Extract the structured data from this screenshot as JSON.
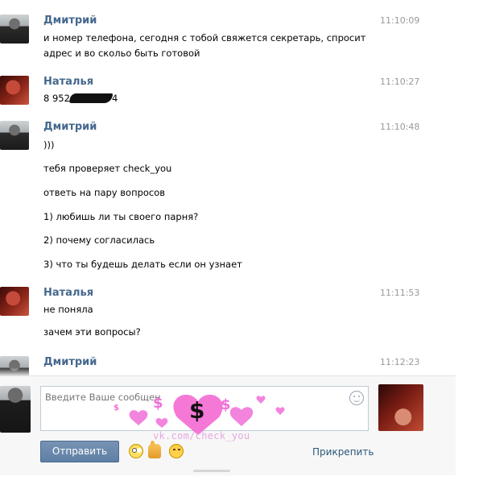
{
  "messages": [
    {
      "author": "Дмитрий",
      "time": "11:10:09",
      "lines": [
        "и номер телефона, сегодня с тобой свяжется секретарь, спросит",
        "адрес и во скольо быть готовой"
      ]
    },
    {
      "author": "Наталья",
      "time": "11:10:27",
      "phone_prefix": "8 952",
      "phone_suffix": "4"
    },
    {
      "author": "Дмитрий",
      "time": "11:10:48",
      "lines": [
        ")))",
        "тебя проверяет check_you",
        "ответь на пару вопросов",
        "1) любишь ли ты своего парня?",
        "2) почему согласилась",
        "3) что ты будешь делать если он узнает"
      ]
    },
    {
      "author": "Наталья",
      "time": "11:11:53",
      "lines": [
        "не поняла",
        "зачем эти вопросы?"
      ]
    },
    {
      "author": "Дмитрий",
      "time": "11:12:23"
    }
  ],
  "composer": {
    "placeholder": "Введите Ваше сообщен",
    "send_label": "Отправить",
    "attach_label": "Прикрепить",
    "emoji": [
      "rolling-eyes-icon",
      "thumbs-up-icon",
      "wink-icon"
    ]
  },
  "watermark": {
    "text": "vk.com/check_you",
    "color": "#ee6fd8"
  }
}
